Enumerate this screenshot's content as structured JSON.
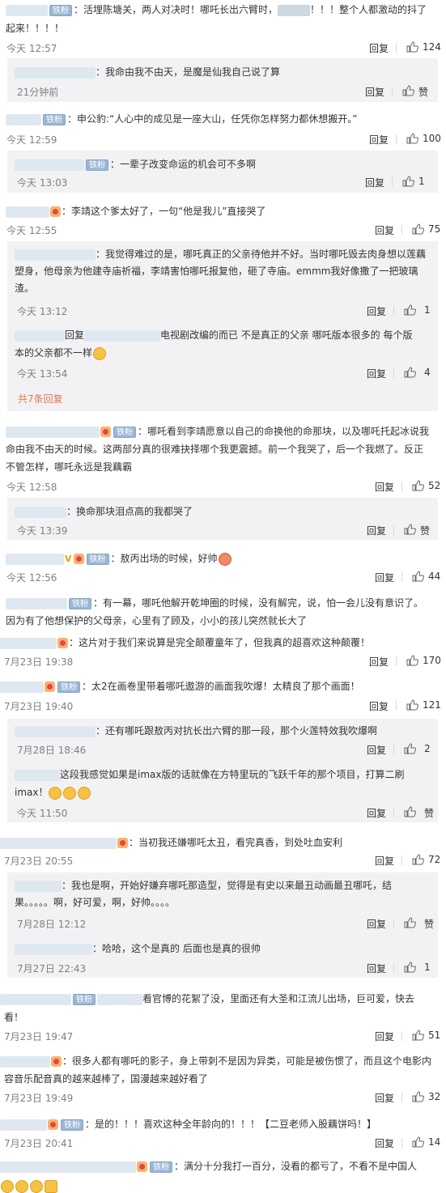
{
  "labels": {
    "reply": "回复",
    "zan": "赞",
    "fan_badge": "铁粉",
    "more_replies": "共7条回复"
  },
  "comments": [
    {
      "text": "：活埋陈塘关，两人对决时！哪吒长出六臂时，",
      "text2": "！！！整个人都激动的抖了",
      "text3": "起来！！！！",
      "time": "今天 12:57",
      "likes": "124"
    },
    {
      "text": "：我命由我不由天，是魔是仙我自己说了算",
      "time": "21分钟前",
      "likes": "赞"
    },
    {
      "text": "：申公豹:“人心中的成见是一座大山，任凭你怎样努力都休想搬开。”",
      "time": "今天 12:59",
      "likes": "100"
    },
    {
      "text": "：一辈子改变命运的机会可不多啊",
      "time": "今天 13:03",
      "likes": "1"
    },
    {
      "text": "：李靖这个爹太好了，一句“他是我儿”直接哭了",
      "time": "今天 12:55",
      "likes": "75"
    },
    {
      "text": "：我觉得难过的是，哪吒真正的父亲待他并不好。当时哪吒毁去肉身想以莲藕",
      "text2": "塑身，他母亲为他建寺庙祈福，李靖害怕哪吒报复他，砸了寺庙。emmm我好像撒了一把玻璃",
      "text3": "渣。",
      "time": "今天 13:12",
      "likes": "1"
    },
    {
      "text_a": "回复",
      "text_b": "电视剧改编的而已 不是真正的父亲 哪吒版本很多的 每个版",
      "text2": "本的父亲都不一样",
      "time": "今天 13:54",
      "likes": "4"
    },
    {
      "text": "：哪吒看到李靖愿意以自己的命换他的命那块，以及哪吒托起冰说我",
      "text2": "命由我不由天的时候。这两部分真的很难抉择哪个我更震撼。前一个我哭了，后一个我燃了。反正",
      "text3": "不管怎样，哪吒永远是我藕霸",
      "time": "今天 12:58",
      "likes": "52"
    },
    {
      "text": "：换命那块泪点高的我都哭了",
      "time": "今天 13:39",
      "likes": "赞"
    },
    {
      "text": "：敖丙出场的时候，好帅",
      "time": "今天 12:56",
      "likes": "44"
    },
    {
      "text": "：有一幕，哪吒他解开乾坤圈的时候，没有解完，说，怕一会儿没有意识了。",
      "text2": "因为有了他想保护的父母亲，心里有了顾及，小小的孩儿突然就长大了"
    },
    {
      "text": "：这片对于我们来说算是完全颠覆童年了，但我真的超喜欢这种颠覆！",
      "time": "7月23日 19:38",
      "likes": "170"
    },
    {
      "text": "：太2在画卷里带着哪吒遨游的画面我吹爆！太精良了那个画面！",
      "time": "7月23日 19:40",
      "likes": "121"
    },
    {
      "text": "：还有哪吒跟敖丙对抗长出六臂的那一段，那个火莲特效我吹爆啊",
      "time": "7月28日 18:46",
      "likes": "2"
    },
    {
      "text": "这段我感觉如果是imax版的话就像在方特里玩的飞跃千年的那个项目，打算二刷",
      "text2": "imax！",
      "time": "今天 11:50",
      "likes": "赞"
    },
    {
      "text": "：当初我还嫌哪吒太丑，看完真香，到处吐血安利",
      "time": "7月23日 20:55",
      "likes": "72"
    },
    {
      "text": "：我也是啊，开始好嫌弃哪吒那造型，觉得是有史以来最丑动画最丑哪吒，结",
      "text2": "果。。。。。啊，好可爱，啊，好帅。。。。",
      "time": "7月28日 12:12",
      "likes": "赞"
    },
    {
      "text": "：哈哈，这个是真的 后面也是真的很帅",
      "time": "7月27日 22:43",
      "likes": "1"
    },
    {
      "text": "看官博的花絮了没，里面还有大圣和江流儿出场，巨可爱，快去",
      "text2": "看！",
      "time": "7月23日 19:47",
      "likes": "51"
    },
    {
      "text": "：很多人都有哪吒的影子，身上带刺不是因为异类，可能是被伤惯了，而且这个电影内",
      "text2": "容音乐配音真的越来越棒了，国漫越来越好看了",
      "time": "7月23日 19:49",
      "likes": "32"
    },
    {
      "text": "：是的！！！喜欢这种全年龄向的！！！【二豆老师入股藕饼吗！】",
      "time": "7月23日 20:41",
      "likes": "14"
    },
    {
      "text": "：满分十分我打一百分，没看的都亏了，不看不是中国人"
    }
  ]
}
